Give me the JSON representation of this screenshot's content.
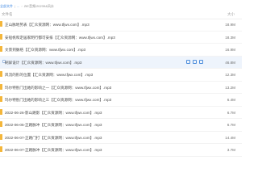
{
  "breadcrumb": {
    "items": [
      "全部文件",
      "..."
    ],
    "current": "ZIE音频/20239&风水"
  },
  "header": {
    "name_col": "文件名",
    "size_col": "大小"
  },
  "files": [
    {
      "name": "正山脉地势表【汇众资源网：www.tfjwx.com】.mp3",
      "size": "18.9M",
      "highlighted": false
    },
    {
      "name": "安船帆和定居家明行都可安排【汇众资源网：www.tfjwx.com】.mp3",
      "size": "18.3M",
      "highlighted": false
    },
    {
      "name": "文景到脉络【汇众资源网：www.tfjwx.com】.mp3",
      "size": "16.9M",
      "highlighted": false
    },
    {
      "name": "刷屏设计【汇众资源网：www.tfjwx.com】.mp3",
      "size": "46.8M",
      "highlighted": true
    },
    {
      "name": "风流的形的位置【汇众资源网：www.tfjwx.com】.mp3",
      "size": "12.3M",
      "highlighted": false
    },
    {
      "name": "玛尔特别门出她的影响之一【汇众资源网：www.tfjwx.com】.mp3",
      "size": "13.2M",
      "highlighted": false
    },
    {
      "name": "玛尔特别门出她的影响之三【汇众资源网：www.tfjwx.com】.mp3",
      "size": "6.4M",
      "highlighted": false
    },
    {
      "name": "2022-06-26-影山路影【汇众资源网：www.tfjwx.com】.mp3",
      "size": "6.7M",
      "highlighted": false
    },
    {
      "name": "2022-06-05-正路脉冲【汇众资源网：www.tfjwx.com】.mp3",
      "size": "6.7M",
      "highlighted": false
    },
    {
      "name": "2022-06-07-正路门打【汇众资源网：www.tfjwx.com】.mp3",
      "size": "14.4M",
      "highlighted": false
    },
    {
      "name": "2022-06-07-正路脉冲【汇众资源网：www.tfjwx.com】.mp3",
      "size": "3.7M",
      "highlighted": false
    }
  ],
  "colors": {
    "link": "#3d87e2",
    "folder": "#f4b63a",
    "highlight_row": "#eef4fc"
  }
}
